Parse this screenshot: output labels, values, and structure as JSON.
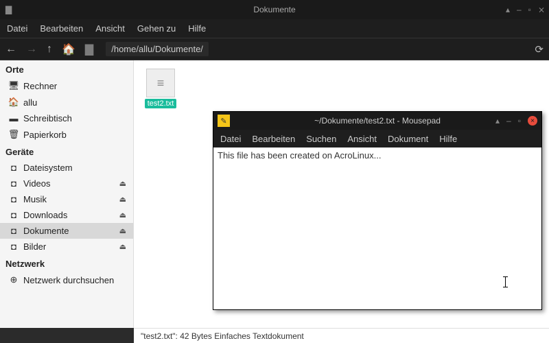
{
  "window": {
    "title": "Dokumente",
    "menus": [
      "Datei",
      "Bearbeiten",
      "Ansicht",
      "Gehen zu",
      "Hilfe"
    ],
    "path": "/home/allu/Dokumente/"
  },
  "sidebar": {
    "sections": [
      {
        "header": "Orte",
        "items": [
          {
            "icon": "🖥",
            "label": "Rechner",
            "eject": false
          },
          {
            "icon": "🏠",
            "label": "allu",
            "eject": false
          },
          {
            "icon": "▬",
            "label": "Schreibtisch",
            "eject": false
          },
          {
            "icon": "🗑",
            "label": "Papierkorb",
            "eject": false
          }
        ]
      },
      {
        "header": "Geräte",
        "items": [
          {
            "icon": "◘",
            "label": "Dateisystem",
            "eject": false
          },
          {
            "icon": "◘",
            "label": "Videos",
            "eject": true
          },
          {
            "icon": "◘",
            "label": "Musik",
            "eject": true
          },
          {
            "icon": "◘",
            "label": "Downloads",
            "eject": true
          },
          {
            "icon": "◘",
            "label": "Dokumente",
            "eject": true,
            "selected": true
          },
          {
            "icon": "◘",
            "label": "Bilder",
            "eject": true
          }
        ]
      },
      {
        "header": "Netzwerk",
        "items": [
          {
            "icon": "⊕",
            "label": "Netzwerk durchsuchen",
            "eject": false
          }
        ]
      }
    ]
  },
  "content": {
    "file_label": "test2.txt"
  },
  "status": "\"test2.txt\": 42 Bytes Einfaches Textdokument",
  "editor": {
    "title": "~/Dokumente/test2.txt - Mousepad",
    "menus": [
      "Datei",
      "Bearbeiten",
      "Suchen",
      "Ansicht",
      "Dokument",
      "Hilfe"
    ],
    "text": "This file has been created on AcroLinux..."
  }
}
